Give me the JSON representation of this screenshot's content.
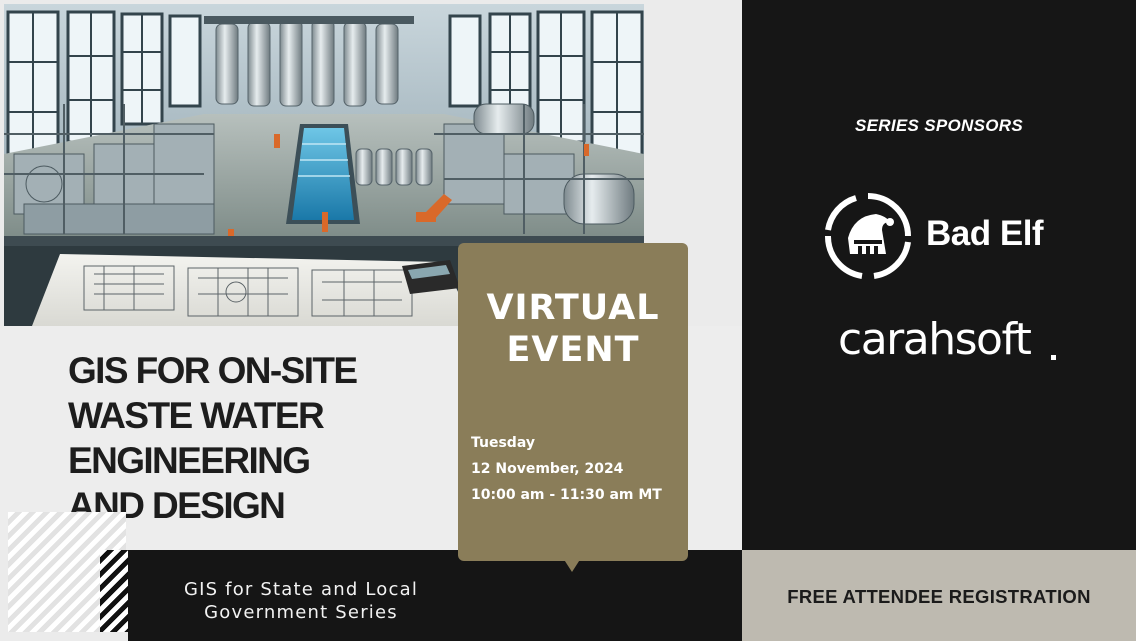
{
  "event": {
    "title_lines": [
      "GIS FOR ON-SITE",
      "WASTE WATER",
      "ENGINEERING",
      "AND DESIGN"
    ],
    "format_lines": [
      "VIRTUAL",
      "EVENT"
    ],
    "day": "Tuesday",
    "date": "12 November, 2024",
    "time": "10:00 am - 11:30 am MT",
    "series_lines": [
      "GIS for State and Local",
      "Government Series"
    ]
  },
  "sponsors": {
    "label": "SERIES SPONSORS",
    "badelf": "Bad Elf",
    "carahsoft": "carahsoft"
  },
  "registration": "FREE ATTENDEE REGISTRATION",
  "colors": {
    "card_gold": "#8a7d59",
    "dark": "#161616",
    "light": "#ededed",
    "strip": "#bebab0"
  },
  "icons": [
    "bad-elf-logo-icon"
  ]
}
